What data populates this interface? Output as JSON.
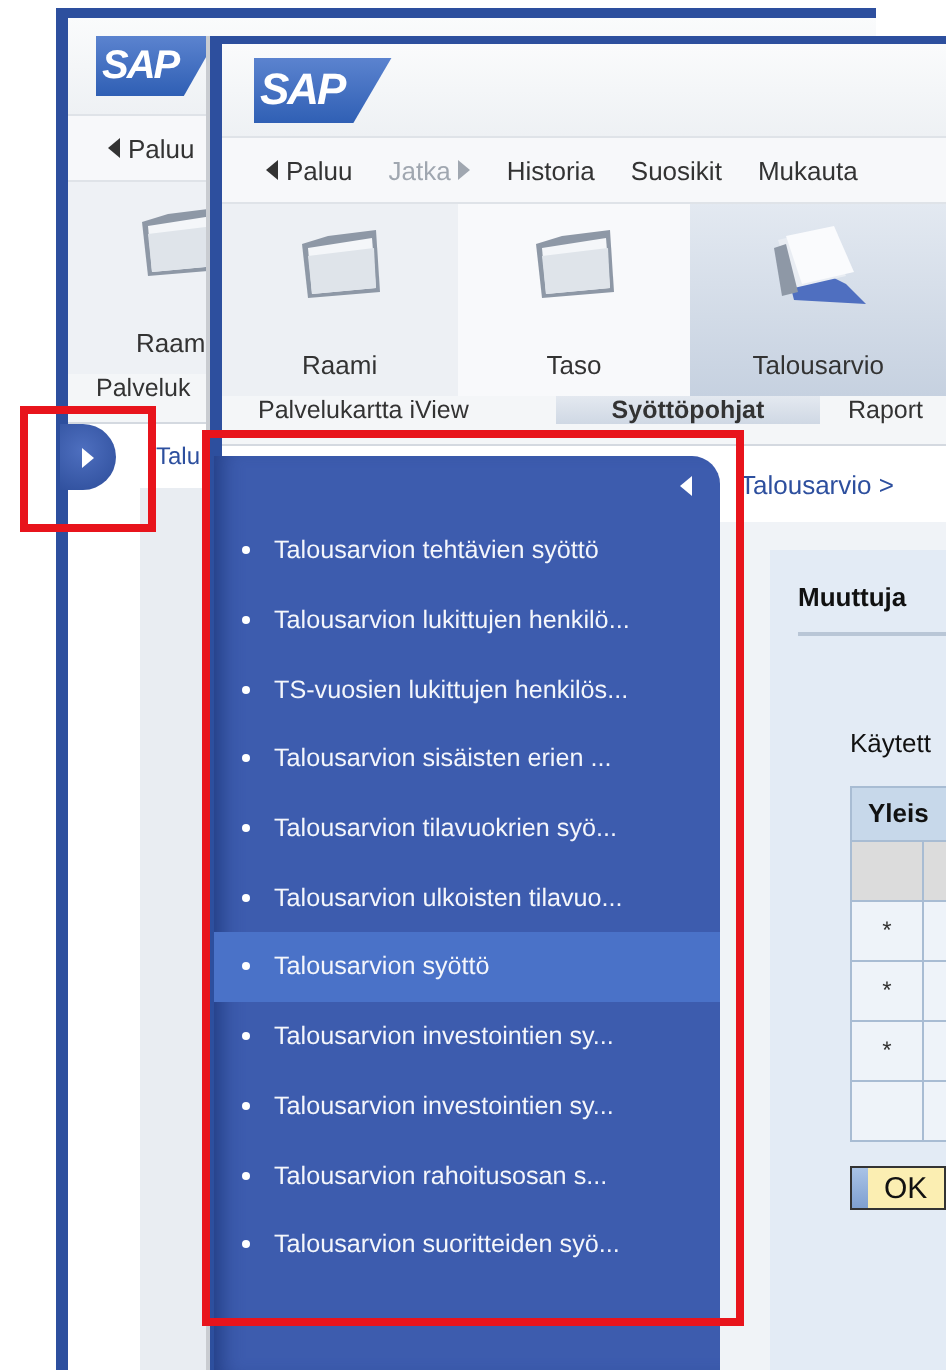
{
  "back_window": {
    "logo": "SAP",
    "nav": [
      {
        "label": "Paluu",
        "kind": "back",
        "disabled": false
      }
    ],
    "toolbar": [
      {
        "label": "Raam"
      }
    ],
    "tabs": [
      {
        "label": "Palveluk"
      }
    ],
    "breadcrumb": "Talu",
    "expand_tab": {
      "expanded": false
    }
  },
  "front_window": {
    "logo": "SAP",
    "nav": [
      {
        "label": "Paluu",
        "kind": "back",
        "disabled": false
      },
      {
        "label": "Jatka",
        "kind": "forward",
        "disabled": true
      },
      {
        "label": "Historia",
        "kind": "menu",
        "disabled": false
      },
      {
        "label": "Suosikit",
        "kind": "menu",
        "disabled": false
      },
      {
        "label": "Mukauta",
        "kind": "menu",
        "disabled": false
      }
    ],
    "toolbar": [
      {
        "label": "Raami",
        "kind": "folder",
        "selected": false
      },
      {
        "label": "Taso",
        "kind": "folder",
        "selected": false
      },
      {
        "label": "Talousarvio",
        "kind": "documents",
        "selected": true
      }
    ],
    "tabs": [
      {
        "label": "Palvelukartta iView",
        "selected": false
      },
      {
        "label": "Syöttöpohjat",
        "selected": true
      },
      {
        "label": "Raport",
        "selected": false
      }
    ],
    "breadcrumb": "Talousarvio >",
    "content": {
      "heading": "Muuttuja",
      "text": "Käytett",
      "table": {
        "header": "Yleis",
        "rows": [
          {
            "marker": "*"
          },
          {
            "marker": "*"
          },
          {
            "marker": "*"
          },
          {}
        ]
      },
      "ok_button": "OK"
    }
  },
  "flyout": {
    "items": [
      {
        "label": "Talousarvion tehtävien syöttö",
        "selected": false
      },
      {
        "label": "Talousarvion lukittujen henkilö...",
        "selected": false
      },
      {
        "label": "TS-vuosien lukittujen henkilös...",
        "selected": false
      },
      {
        "label": "Talousarvion sisäisten erien ...",
        "selected": false
      },
      {
        "label": "Talousarvion tilavuokrien syö...",
        "selected": false
      },
      {
        "label": "Talousarvion ulkoisten tilavuo...",
        "selected": false
      },
      {
        "label": "Talousarvion syöttö",
        "selected": true
      },
      {
        "label": "Talousarvion investointien sy...",
        "selected": false
      },
      {
        "label": "Talousarvion investointien sy...",
        "selected": false
      },
      {
        "label": "Talousarvion rahoitusosan s...",
        "selected": false
      },
      {
        "label": "Talousarvion suoritteiden syö...",
        "selected": false
      }
    ]
  }
}
